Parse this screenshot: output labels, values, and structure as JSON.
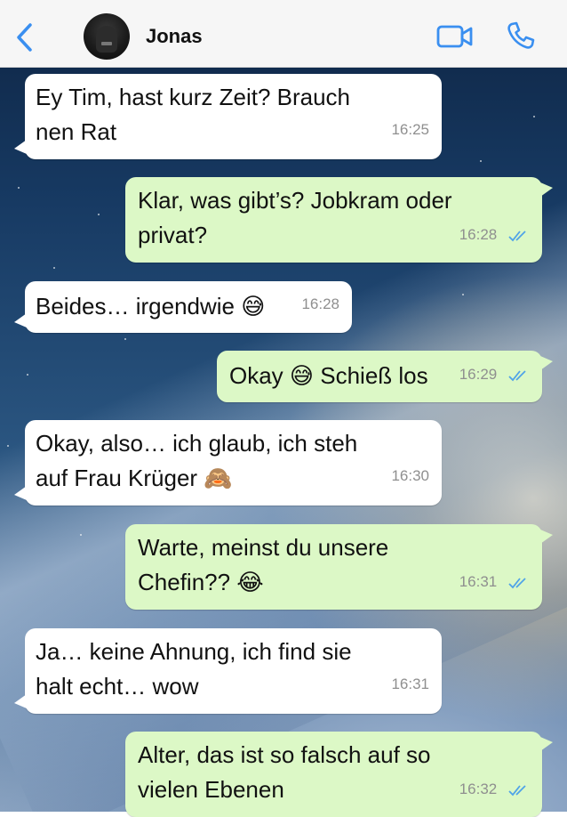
{
  "header": {
    "contact_name": "Jonas",
    "back_icon": "chevron-left-icon",
    "video_icon": "video-camera-icon",
    "call_icon": "phone-icon",
    "accent": "#3a8ff0"
  },
  "colors": {
    "incoming_bubble": "#ffffff",
    "outgoing_bubble": "#dcf8c6",
    "read_ticks": "#4fa3e8"
  },
  "messages": [
    {
      "direction": "in",
      "line1": "Ey Tim, hast kurz Zeit? Brauch",
      "line2": "nen Rat",
      "time": "16:25"
    },
    {
      "direction": "out",
      "line1": "Klar, was gibt’s? Jobkram oder",
      "line2": "privat?",
      "time": "16:28",
      "status": "read"
    },
    {
      "direction": "in",
      "line1": "Beides… irgendwie 😅",
      "time": "16:28"
    },
    {
      "direction": "out",
      "line1": "Okay 😅 Schieß los",
      "time": "16:29",
      "status": "read"
    },
    {
      "direction": "in",
      "line1": "Okay, also… ich glaub, ich steh",
      "line2": "auf Frau Krüger 🙈",
      "time": "16:30"
    },
    {
      "direction": "out",
      "line1": "Warte, meinst du unsere",
      "line2": "Chefin?? 😂",
      "time": "16:31",
      "status": "read"
    },
    {
      "direction": "in",
      "line1": "Ja… keine Ahnung, ich find sie",
      "line2": "halt echt… wow",
      "time": "16:31"
    },
    {
      "direction": "out",
      "line1": "Alter, das ist so falsch auf so",
      "line2": "vielen Ebenen",
      "time": "16:32",
      "status": "read"
    }
  ]
}
